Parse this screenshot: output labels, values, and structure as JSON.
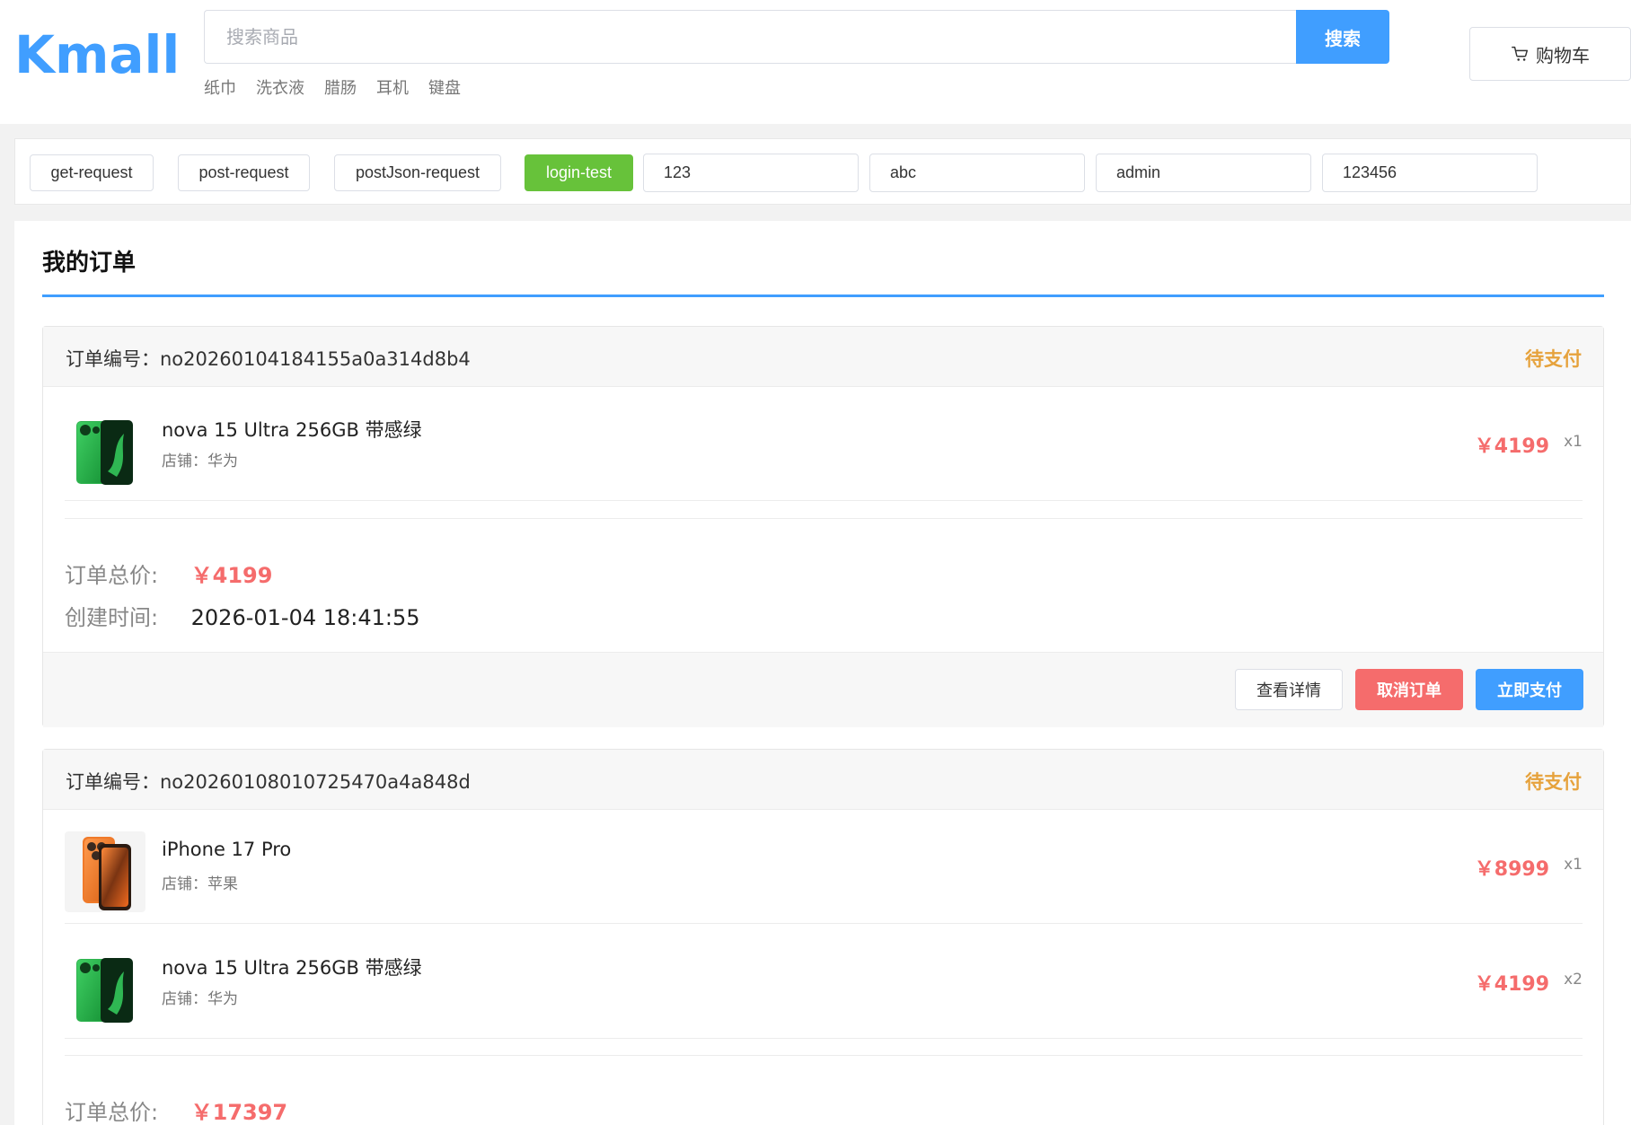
{
  "header": {
    "logo": "Kmall",
    "search_placeholder": "搜索商品",
    "search_button": "搜索",
    "hot_words": [
      "纸巾",
      "洗衣液",
      "腊肠",
      "耳机",
      "键盘"
    ],
    "cart_label": "购物车"
  },
  "test_bar": {
    "buttons": [
      "get-request",
      "post-request",
      "postJson-request",
      "login-test"
    ],
    "inputs": [
      "123",
      "abc",
      "admin",
      "123456"
    ]
  },
  "page": {
    "title": "我的订单"
  },
  "labels": {
    "order_no": "订单编号：",
    "shop": "店铺：",
    "total": "订单总价:",
    "created": "创建时间:",
    "view_detail": "查看详情",
    "cancel_order": "取消订单",
    "pay_now": "立即支付"
  },
  "orders": [
    {
      "order_no": "no20260104184155a0a314d8b4",
      "status": "待支付",
      "items": [
        {
          "name": "nova 15 Ultra 256GB 带感绿",
          "shop": "华为",
          "price": "￥4199",
          "qty": "x1",
          "thumb": "green-phone"
        }
      ],
      "total": "￥4199",
      "created_at": "2026-01-04 18:41:55"
    },
    {
      "order_no": "no20260108010725470a4a848d",
      "status": "待支付",
      "items": [
        {
          "name": "iPhone 17 Pro",
          "shop": "苹果",
          "price": "￥8999",
          "qty": "x1",
          "thumb": "orange-phone"
        },
        {
          "name": "nova 15 Ultra 256GB 带感绿",
          "shop": "华为",
          "price": "￥4199",
          "qty": "x2",
          "thumb": "green-phone"
        }
      ],
      "total": "￥17397"
    }
  ],
  "colors": {
    "primary": "#409eff",
    "success": "#67c23a",
    "danger": "#f56c6c",
    "warning": "#e6a23c"
  }
}
